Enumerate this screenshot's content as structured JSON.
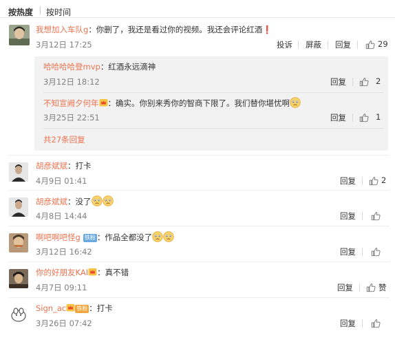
{
  "sort": {
    "hot": "按热度",
    "time": "按时间"
  },
  "main_comment": {
    "user": "我想加入车队g",
    "text": "：你删了，我还是看过你的视频。我还会评论红酒❗",
    "time": "3月12日 17:25",
    "report": "投诉",
    "block": "屏蔽",
    "reply": "回复",
    "likes": "29"
  },
  "replies": [
    {
      "user": "哈哈哈哈登mvp",
      "text": "：红酒永远滴神",
      "time": "3月12日 18:12",
      "reply": "回复",
      "likes": "2"
    },
    {
      "user": "不知宣阙夕何年",
      "text": "：确实。你别来秀你的智商下限了。我们替你堪忧啊",
      "time": "3月25日 22:51",
      "reply": "回复",
      "likes": "1"
    }
  ],
  "more_replies": "共27条回复",
  "comments": [
    {
      "user": "胡彦斌斌",
      "text": "：打卡",
      "time": "4月9日 01:41",
      "reply": "回复",
      "likes": "2",
      "badge": ""
    },
    {
      "user": "胡彦斌斌",
      "text": "：没了",
      "time": "4月8日 14:44",
      "reply": "回复",
      "likes": "",
      "badge": ""
    },
    {
      "user": "啊吧啊吧怪g",
      "text": "：作品全都没了",
      "time": "3月12日 16:42",
      "reply": "回复",
      "likes": "",
      "badge": "铁粉"
    },
    {
      "user": "你的好朋友KAI",
      "text": "：真不错",
      "time": "4月7日 09:11",
      "reply": "回复",
      "likes": "赞",
      "badge": ""
    },
    {
      "user": "Sign_ac",
      "text": "：打卡",
      "time": "3月26日 07:42",
      "reply": "回复",
      "likes": "",
      "badge": "铁粉"
    }
  ],
  "colors": {
    "username": "#eb7350",
    "reply_box": "#f2f2f2",
    "fan_badge": "#6aa9e0"
  }
}
